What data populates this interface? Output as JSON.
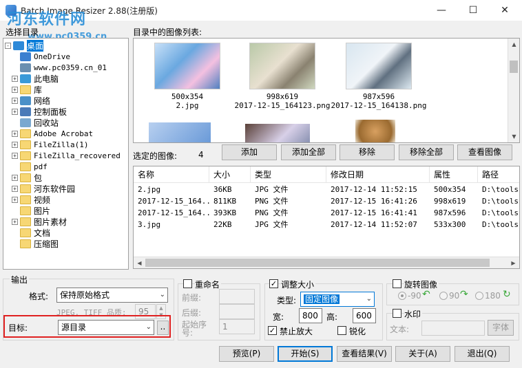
{
  "window": {
    "title": "Batch Image Resizer 2.88(注册版)",
    "watermark_logo": "河东软件网",
    "watermark_url": "www.pc0359.cn",
    "controls": {
      "minimize": "—",
      "maximize": "☐",
      "close": "✕"
    }
  },
  "left_panel": {
    "label": "选择目录",
    "tree": [
      {
        "label": "桌面",
        "icon": "desktop-icon",
        "level": 0,
        "expander": "-",
        "selected": true
      },
      {
        "label": "OneDrive",
        "icon": "cloud-icon",
        "level": 1,
        "expander": ""
      },
      {
        "label": "www.pc0359.cn_01",
        "icon": "user-icon",
        "level": 1,
        "expander": ""
      },
      {
        "label": "此电脑",
        "icon": "computer-icon",
        "level": 1,
        "expander": "+"
      },
      {
        "label": "库",
        "icon": "folder-icon",
        "level": 1,
        "expander": "+"
      },
      {
        "label": "网络",
        "icon": "network-icon",
        "level": 1,
        "expander": "+"
      },
      {
        "label": "控制面板",
        "icon": "control-panel-icon",
        "level": 1,
        "expander": "+"
      },
      {
        "label": "回收站",
        "icon": "recycle-bin-icon",
        "level": 1,
        "expander": ""
      },
      {
        "label": "Adobe Acrobat",
        "icon": "folder-icon",
        "level": 1,
        "expander": "+"
      },
      {
        "label": "FileZilla(1)",
        "icon": "folder-icon",
        "level": 1,
        "expander": "+"
      },
      {
        "label": "FileZilla_recovered",
        "icon": "folder-icon",
        "level": 1,
        "expander": "+"
      },
      {
        "label": "pdf",
        "icon": "folder-icon",
        "level": 1,
        "expander": ""
      },
      {
        "label": "包",
        "icon": "folder-icon",
        "level": 1,
        "expander": "+"
      },
      {
        "label": "河东软件园",
        "icon": "folder-icon",
        "level": 1,
        "expander": "+"
      },
      {
        "label": "视频",
        "icon": "folder-icon",
        "level": 1,
        "expander": "+"
      },
      {
        "label": "图片",
        "icon": "folder-icon",
        "level": 1,
        "expander": ""
      },
      {
        "label": "图片素材",
        "icon": "folder-icon",
        "level": 1,
        "expander": "+"
      },
      {
        "label": "文档",
        "icon": "folder-icon",
        "level": 1,
        "expander": ""
      },
      {
        "label": "压缩图",
        "icon": "folder-icon",
        "level": 1,
        "expander": ""
      }
    ]
  },
  "thumbnails": {
    "label": "目录中的图像列表:",
    "items": [
      {
        "size": "500x354",
        "name": "2.jpg",
        "selected": true
      },
      {
        "size": "998x619",
        "name": "2017-12-15_164123.png",
        "selected": true
      },
      {
        "size": "987x596",
        "name": "2017-12-15_164138.png",
        "selected": true
      }
    ]
  },
  "selection": {
    "label": "选定的图像:",
    "count": "4",
    "buttons": {
      "add": "添加",
      "add_all": "添加全部",
      "remove": "移除",
      "remove_all": "移除全部",
      "view": "查看图像"
    }
  },
  "file_table": {
    "columns": [
      "名称",
      "大小",
      "类型",
      "修改日期",
      "属性",
      "路径"
    ],
    "rows": [
      [
        "2.jpg",
        "36KB",
        "JPG 文件",
        "2017-12-14  11:52:15",
        "500x354",
        "D:\\tools"
      ],
      [
        "2017-12-15_164...",
        "811KB",
        "PNG 文件",
        "2017-12-15  16:41:26",
        "998x619",
        "D:\\tools"
      ],
      [
        "2017-12-15_164...",
        "393KB",
        "PNG 文件",
        "2017-12-15  16:41:41",
        "987x596",
        "D:\\tools"
      ],
      [
        "3.jpg",
        "22KB",
        "JPG 文件",
        "2017-12-14  11:52:07",
        "533x300",
        "D:\\tools"
      ]
    ]
  },
  "output": {
    "group_label": "输出",
    "format_label": "格式:",
    "format_value": "保持原始格式",
    "quality_label": "JPEG, TIFF 品质:",
    "quality_value": "95",
    "target_label": "目标:",
    "target_value": "源目录",
    "browse_label": ".."
  },
  "rename": {
    "label": "重命名",
    "prefix_label": "前缀:",
    "suffix_label": "后缀:",
    "start_label": "起始序号:",
    "start_value": "1"
  },
  "resize": {
    "label": "调整大小",
    "checked": true,
    "type_label": "类型:",
    "type_value": "固定图像",
    "width_label": "宽:",
    "width_value": "800",
    "height_label": "高:",
    "height_value": "600",
    "no_enlarge_label": "禁止放大",
    "no_enlarge_checked": true,
    "sharpen_label": "锐化",
    "sharpen_checked": false
  },
  "rotate": {
    "label": "旋转图像",
    "options": [
      "-90",
      "90",
      "180"
    ]
  },
  "watermark": {
    "label": "水印",
    "text_label": "文本:",
    "font_button": "字体"
  },
  "actions": {
    "preview": "预览(P)",
    "start": "开始(S)",
    "view_result": "查看结果(V)",
    "about": "关于(A)",
    "exit": "退出(Q)"
  }
}
